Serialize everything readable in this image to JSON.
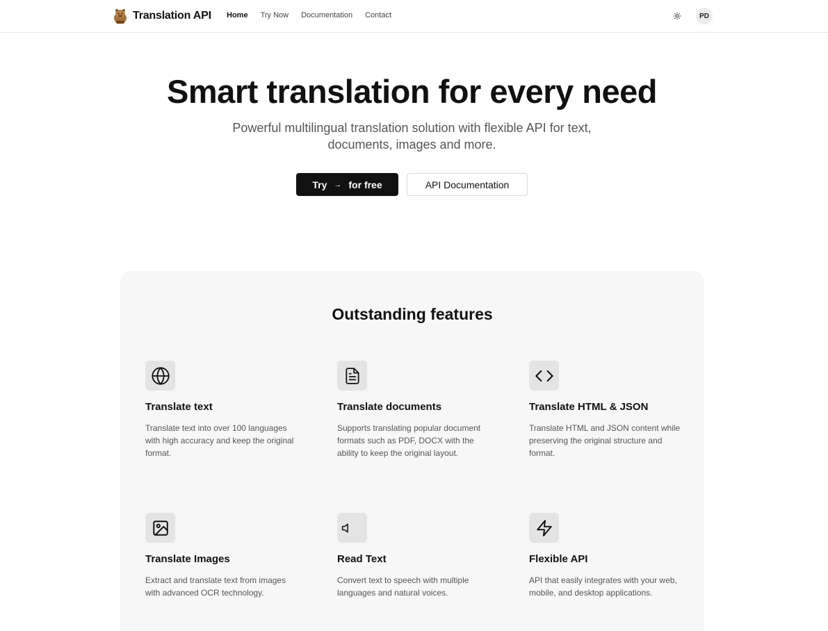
{
  "header": {
    "brand": "Translation API",
    "logo_icon": "capybara-logo-icon",
    "nav": [
      {
        "label": "Home",
        "active": true
      },
      {
        "label": "Try Now",
        "active": false
      },
      {
        "label": "Documentation",
        "active": false
      },
      {
        "label": "Contact",
        "active": false
      }
    ],
    "theme_icon": "sun-icon",
    "avatar_initials": "PD"
  },
  "hero": {
    "title": "Smart translation for every need",
    "subtitle": "Powerful multilingual translation solution with flexible API for text, documents, images and more.",
    "primary_button": {
      "pre": "Try",
      "arrow": "→",
      "post": "for free"
    },
    "secondary_button": "API Documentation"
  },
  "features": {
    "title": "Outstanding features",
    "items": [
      {
        "icon": "globe-icon",
        "title": "Translate text",
        "description": "Translate text into over 100 languages with high accuracy and keep the original format."
      },
      {
        "icon": "document-icon",
        "title": "Translate documents",
        "description": "Supports translating popular document formats such as PDF, DOCX with the ability to keep the original layout."
      },
      {
        "icon": "code-icon",
        "title": "Translate HTML & JSON",
        "description": "Translate HTML and JSON content while preserving the original structure and format."
      },
      {
        "icon": "image-icon",
        "title": "Translate Images",
        "description": "Extract and translate text from images with advanced OCR technology."
      },
      {
        "icon": "speaker-icon",
        "title": "Read Text",
        "description": "Convert text to speech with multiple languages and natural voices."
      },
      {
        "icon": "lightning-icon",
        "title": "Flexible API",
        "description": "API that easily integrates with your web, mobile, and desktop applications."
      }
    ]
  },
  "colors": {
    "primary": "#111111",
    "panel": "#f7f7f7",
    "icon_tile": "#e4e4e4",
    "muted_text": "#555555"
  }
}
